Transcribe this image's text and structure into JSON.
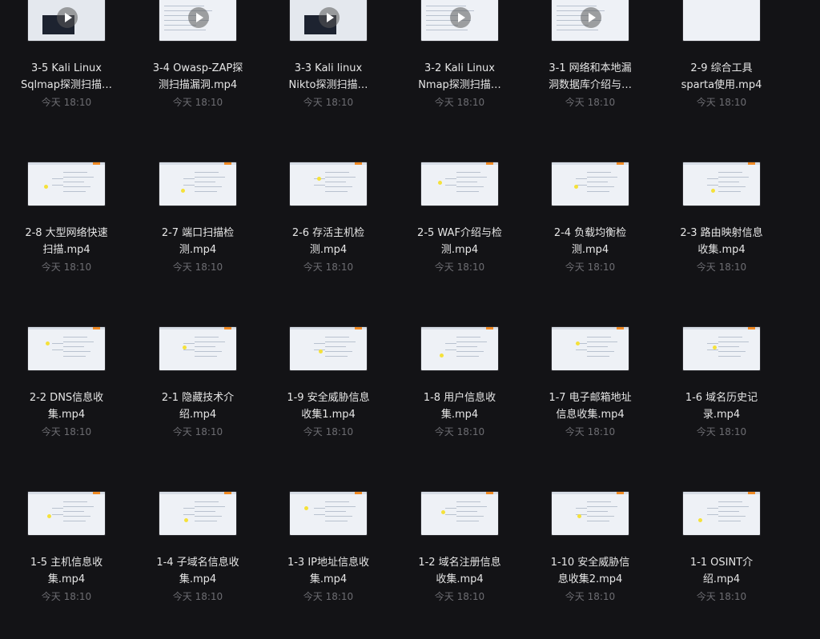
{
  "files": [
    {
      "title": "3-5 Kali Linux\nSqlmap探测扫描…",
      "time": "今天 18:10",
      "thumb": "code"
    },
    {
      "title": "3-4 Owasp-ZAP探\n测扫描漏洞.mp4",
      "time": "今天 18:10",
      "thumb": "doc"
    },
    {
      "title": "3-3 Kali linux\nNikto探测扫描…",
      "time": "今天 18:10",
      "thumb": "code"
    },
    {
      "title": "3-2 Kali Linux\nNmap探测扫描…",
      "time": "今天 18:10",
      "thumb": "doc"
    },
    {
      "title": "3-1 网络和本地漏\n洞数据库介绍与…",
      "time": "今天 18:10",
      "thumb": "doc"
    },
    {
      "title": "2-9 综合工具\nsparta使用.mp4",
      "time": "今天 18:10",
      "thumb": "light"
    },
    {
      "title": "2-8 大型网络快速\n扫描.mp4",
      "time": "今天 18:10",
      "thumb": "mind"
    },
    {
      "title": "2-7 端口扫描检\n测.mp4",
      "time": "今天 18:10",
      "thumb": "mind"
    },
    {
      "title": "2-6 存活主机检\n测.mp4",
      "time": "今天 18:10",
      "thumb": "mind"
    },
    {
      "title": "2-5 WAF介绍与检\n测.mp4",
      "time": "今天 18:10",
      "thumb": "mind"
    },
    {
      "title": "2-4 负载均衡检\n测.mp4",
      "time": "今天 18:10",
      "thumb": "mind"
    },
    {
      "title": "2-3 路由映射信息\n收集.mp4",
      "time": "今天 18:10",
      "thumb": "mind"
    },
    {
      "title": "2-2 DNS信息收\n集.mp4",
      "time": "今天 18:10",
      "thumb": "mind"
    },
    {
      "title": "2-1 隐藏技术介\n绍.mp4",
      "time": "今天 18:10",
      "thumb": "mind"
    },
    {
      "title": "1-9 安全威胁信息\n收集1.mp4",
      "time": "今天 18:10",
      "thumb": "mind"
    },
    {
      "title": "1-8 用户信息收\n集.mp4",
      "time": "今天 18:10",
      "thumb": "mind"
    },
    {
      "title": "1-7 电子邮箱地址\n信息收集.mp4",
      "time": "今天 18:10",
      "thumb": "mind"
    },
    {
      "title": "1-6 域名历史记\n录.mp4",
      "time": "今天 18:10",
      "thumb": "mind"
    },
    {
      "title": "1-5 主机信息收\n集.mp4",
      "time": "今天 18:10",
      "thumb": "mind"
    },
    {
      "title": "1-4 子域名信息收\n集.mp4",
      "time": "今天 18:10",
      "thumb": "mind"
    },
    {
      "title": "1-3 IP地址信息收\n集.mp4",
      "time": "今天 18:10",
      "thumb": "mind"
    },
    {
      "title": "1-2 域名注册信息\n收集.mp4",
      "time": "今天 18:10",
      "thumb": "mind"
    },
    {
      "title": "1-10 安全威胁信\n息收集2.mp4",
      "time": "今天 18:10",
      "thumb": "mind"
    },
    {
      "title": "1-1 OSINT介\n绍.mp4",
      "time": "今天 18:10",
      "thumb": "mind"
    }
  ]
}
